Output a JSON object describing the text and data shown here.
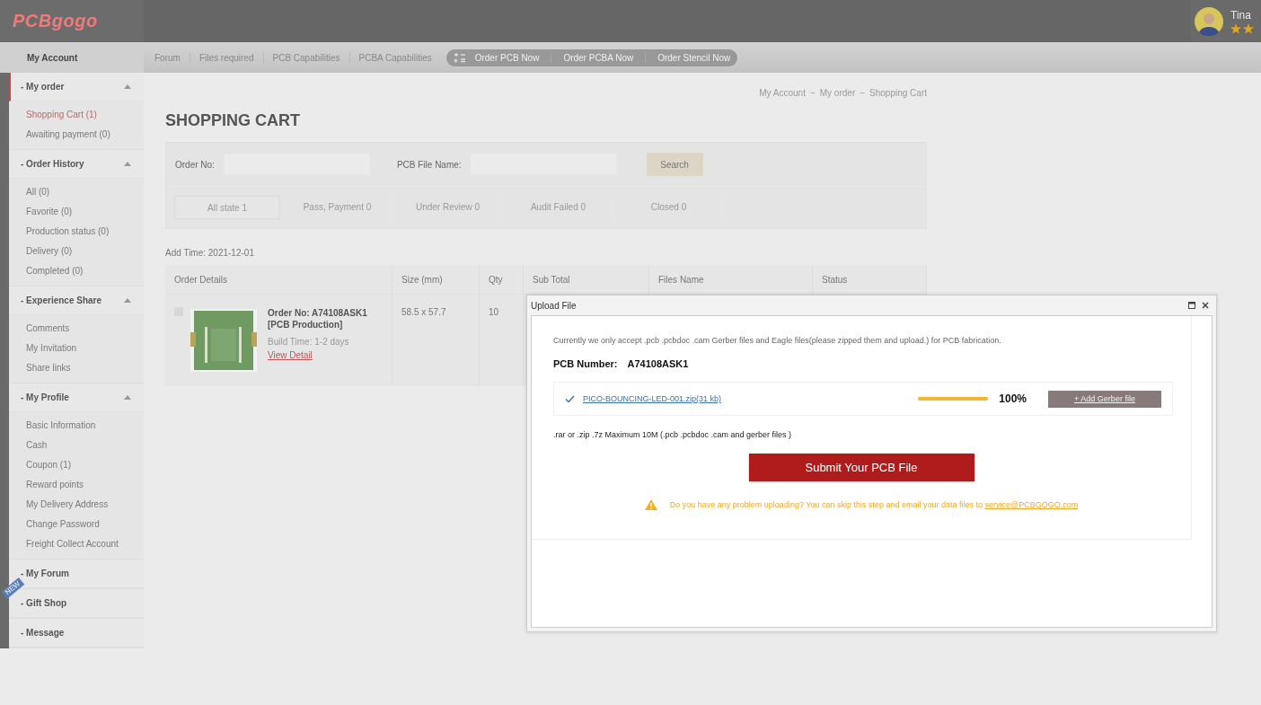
{
  "header": {
    "logo": "PCBgogo",
    "user": {
      "name": "Tina"
    }
  },
  "nav": {
    "account": "My Account",
    "links": [
      "Forum",
      "Files required",
      "PCB Capabilities",
      "PCBA Capabilities"
    ],
    "order_buttons": [
      "Order PCB Now",
      "Order PCBA Now",
      "Order Stencil Now"
    ]
  },
  "sidebar": [
    {
      "title": "- My order",
      "active": true,
      "items": [
        {
          "label": "Shopping Cart (1)",
          "selected": true
        },
        {
          "label": "Awaiting payment (0)",
          "selected": false
        }
      ]
    },
    {
      "title": "- Order History",
      "active": false,
      "items": [
        {
          "label": "All (0)",
          "selected": false
        },
        {
          "label": "Favorite (0)",
          "selected": false
        },
        {
          "label": "Production status (0)",
          "selected": false
        },
        {
          "label": "Delivery (0)",
          "selected": false
        },
        {
          "label": "Completed (0)",
          "selected": false
        }
      ]
    },
    {
      "title": "- Experience Share",
      "active": false,
      "items": [
        {
          "label": "Comments",
          "selected": false
        },
        {
          "label": "My Invitation",
          "selected": false
        },
        {
          "label": "Share links",
          "selected": false
        }
      ]
    },
    {
      "title": "- My Profile",
      "active": false,
      "items": [
        {
          "label": "Basic Information",
          "selected": false
        },
        {
          "label": "Cash",
          "selected": false
        },
        {
          "label": "Coupon (1)",
          "selected": false
        },
        {
          "label": "Reward points",
          "selected": false
        },
        {
          "label": "My Delivery Address",
          "selected": false
        },
        {
          "label": "Change Password",
          "selected": false
        },
        {
          "label": "Freight Collect Account",
          "selected": false
        }
      ]
    },
    {
      "title": "- My Forum",
      "active": false
    },
    {
      "title": "- Gift Shop",
      "active": false,
      "badge": "NEW"
    },
    {
      "title": "- Message",
      "active": false
    }
  ],
  "breadcrumb": {
    "items": [
      "My Account",
      "My order",
      "Shopping Cart"
    ],
    "separator": "−"
  },
  "page_title": "SHOPPING CART",
  "filters": {
    "order_no_label": "Order No:",
    "file_name_label": "PCB File Name:",
    "search_button": "Search"
  },
  "state_tabs": [
    {
      "label": "All state 1",
      "selected": true
    },
    {
      "label": "Pass, Payment 0",
      "selected": false
    },
    {
      "label": "Under Review 0",
      "selected": false
    },
    {
      "label": "Audit Failed 0",
      "selected": false
    },
    {
      "label": "Closed 0",
      "selected": false
    }
  ],
  "add_time": "Add Time: 2021-12-01",
  "table": {
    "columns": [
      "Order Details",
      "Size (mm)",
      "Qty",
      "Sub Total",
      "Files Name",
      "Status"
    ],
    "rows": [
      {
        "checked": false,
        "order_no": "Order No: A74108ASK1",
        "type": "[PCB Production]",
        "build_time": "Build Time: 1-2 days",
        "link": "View Detail",
        "size": "58.5 x 57.7",
        "qty": "10"
      }
    ]
  },
  "dialog": {
    "title": "Upload File",
    "note": "Currently we only accept .pcb .pcbdoc .cam Gerber files and Eagle files(please zipped them and upload.) for PCB fabrication.",
    "pcb_number_label": "PCB Number:",
    "pcb_number": "A74108ASK1",
    "file": {
      "name": "PICO-BOUNCING-LED-001.zip(31 kb)",
      "level": 1,
      "percent": "100%"
    },
    "add_button": "+ Add Gerber file",
    "hint": ".rar or .zip .7z Maximum 10M (.pcb .pcbdoc .cam and gerber files )",
    "submit_button": "Submit Your PCB File",
    "warning": "Do you have any problem uploading? You can skip this step and email your data files to",
    "email": "service@PCBGOGO.com"
  }
}
